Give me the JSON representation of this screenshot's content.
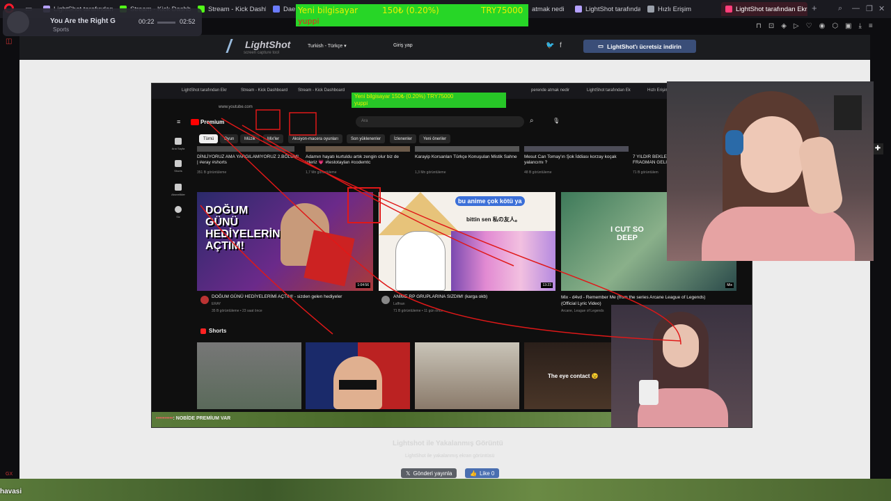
{
  "browser": {
    "tabs": [
      {
        "label": "LightShot tarafından",
        "color": "#b5a1ff"
      },
      {
        "label": "Stream - Kick Dashb",
        "color": "#53fc18"
      },
      {
        "label": "Stream - Kick Dashb",
        "color": "#53fc18"
      },
      {
        "label": "Daem",
        "color": "#6b7cff"
      },
      {
        "label": "atmak nedi",
        "color": "#ff6a3a"
      },
      {
        "label": "LightShot tarafından",
        "color": "#b5a1ff"
      },
      {
        "label": "Hızlı Erişim",
        "color": "#9aa0aa"
      },
      {
        "label": "LightShot tarafından Ekran",
        "color": "#ff3e7a"
      }
    ],
    "new_tab": "+"
  },
  "music_widget": {
    "title": "You Are the Right G",
    "category": "Sports",
    "elapsed": "00:22",
    "total": "02:52"
  },
  "overlay": {
    "line1_a": "Yeni bilgisayar",
    "line1_b": "150₺ (0.20%)",
    "line1_c": "TRY75000",
    "line2": "yuppi"
  },
  "site_header": {
    "logo": "LightShot",
    "logo_sub": "screen capture tool",
    "language": "Turkish - Türkçe",
    "login": "Giriş yap",
    "twitter_icon": "twitter-icon",
    "facebook_icon": "facebook-icon",
    "download_label": "LightShot'ı ücretsiz indirin",
    "colors": {
      "header_bg": "#1b1c1f",
      "download_bg": "#3a4e78",
      "page_bg": "#ececec"
    }
  },
  "screenshot": {
    "inner_tabs": [
      "LightShot tarafından Ekr",
      "Stream - Kick Dashboard",
      "Stream - Kick Dashboard",
      "perende atmak nedir",
      "LightShot tarafından Ek",
      "Hızlı Erişim"
    ],
    "overlay_text": "Yeni bilgisayar  150₺ (0.20%)  TRY75000",
    "overlay_sub": "yuppi",
    "url": "www.youtube.com",
    "brand": "Premium",
    "search_placeholder": "Ara",
    "chips": [
      "Tümü",
      "Oyun",
      "Müzik",
      "Mix'ler",
      "Aksiyon-macera oyunları",
      "Son yüklenenler",
      "İzlenenler",
      "Yeni öneriler"
    ],
    "nav": [
      "Ana Sayfa",
      "Shorts",
      "Abonelikler",
      "Siz"
    ],
    "row1": [
      {
        "title": "DİNLİYORUZ AMA YARGILAMIYORUZ 2.BÖLÜM! | #eray #shorts",
        "meta": "351 B görüntüleme"
      },
      {
        "title": "Adamın hayatı kurtuldu artık zengin olur biz de izleriz 💗 #testotaylan #codemtc",
        "meta": "1,7 Mn görüntüleme"
      },
      {
        "title": "Karayip Korsanları Türkçe Konuşulan Mistik Sahne",
        "meta": "1,3 Mn görüntüleme"
      },
      {
        "title": "Mesut Can Tomay'ın Şok İddiası korzay koçak yalancımı ?",
        "meta": "48 B görüntüleme"
      },
      {
        "title": "7 YILDIR BEKLE FRAGMAN GELI",
        "meta": "71 B görüntülem"
      }
    ],
    "videos": [
      {
        "title": "DOĞUM GÜNÜ HEDİYELERİMİ AÇTIM! - sizden gelen hediyeler",
        "channel": "ERAY",
        "meta": "35 B görüntüleme • 23 saat önce",
        "duration": "1:04:56",
        "thumb_text": "DOĞUM GÜNÜ HEDİYELERİNİ AÇTIM!"
      },
      {
        "title": "ANİME RP GRUPLARINA SIZDIM! (karga okb)",
        "channel": "Laffnan",
        "meta": "71 B görüntüleme • 11 gün önce",
        "duration": "13:23",
        "thumb_text": "bu anime çok kötü ya",
        "thumb_text2": "bittin sen 私の友人。"
      },
      {
        "title": "Mix - d4vd - Remember Me (from the series Arcane League of Legends) (Official Lyric Video)",
        "channel": "Arcane, League of Legends",
        "meta": "",
        "duration": "Mix",
        "thumb_text": "I CUT SO DEEP"
      }
    ],
    "shorts_label": "Shorts",
    "shorts_caption": "The eye contact 😉",
    "chat_user": "••••••••••",
    "chat_msg": ": NOBİDE PREMİUM VAR"
  },
  "page": {
    "caption_title": "Lightshot ile Yakalanmış Görüntü",
    "caption_sub": "LightShot ile yakalanmış ekran görüntüsü",
    "share_label": "Gönderi yayınla",
    "like_label": "Like 0",
    "bottom_text": "havasi"
  }
}
